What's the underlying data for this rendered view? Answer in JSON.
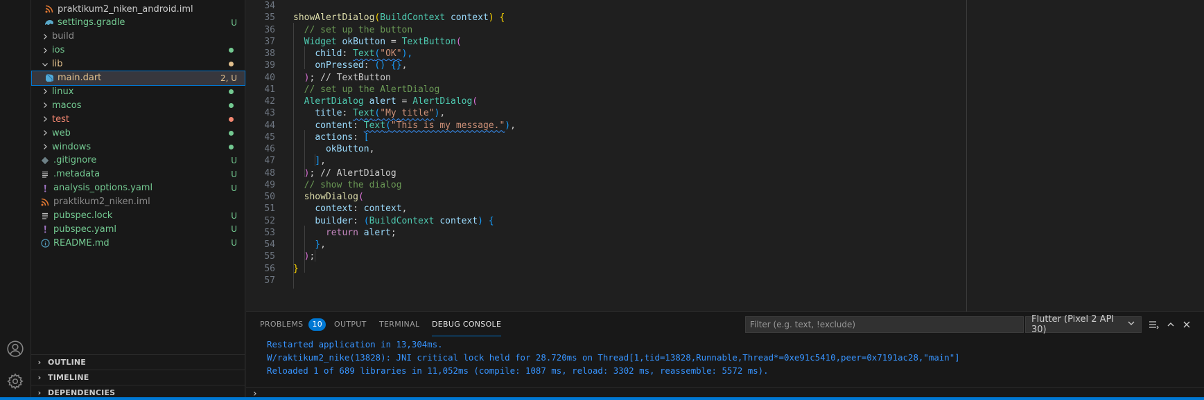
{
  "explorer": {
    "items": [
      {
        "label": "praktikum2_niken_android.iml",
        "icon": "rss-icon",
        "indent": 1,
        "color": "#cccccc",
        "badge": "",
        "dot": "",
        "chevron": "",
        "selected": false
      },
      {
        "label": "settings.gradle",
        "icon": "gradle-icon",
        "indent": 1,
        "color": "#73c991",
        "badge": "U",
        "dot": "",
        "chevron": "",
        "selected": false
      },
      {
        "label": "build",
        "icon": "",
        "indent": 0,
        "color": "#8c8c8c",
        "badge": "",
        "dot": "",
        "chevron": "right",
        "selected": false
      },
      {
        "label": "ios",
        "icon": "",
        "indent": 0,
        "color": "#73c991",
        "badge": "",
        "dot": "#73c991",
        "chevron": "right",
        "selected": false
      },
      {
        "label": "lib",
        "icon": "",
        "indent": 0,
        "color": "#e2c08d",
        "badge": "",
        "dot": "#e2c08d",
        "chevron": "down",
        "selected": false
      },
      {
        "label": "main.dart",
        "icon": "dart-icon",
        "indent": 1,
        "color": "#e2c08d",
        "badge": "2, U",
        "dot": "",
        "chevron": "",
        "selected": true
      },
      {
        "label": "linux",
        "icon": "",
        "indent": 0,
        "color": "#73c991",
        "badge": "",
        "dot": "#73c991",
        "chevron": "right",
        "selected": false
      },
      {
        "label": "macos",
        "icon": "",
        "indent": 0,
        "color": "#73c991",
        "badge": "",
        "dot": "#73c991",
        "chevron": "right",
        "selected": false
      },
      {
        "label": "test",
        "icon": "",
        "indent": 0,
        "color": "#f48771",
        "badge": "",
        "dot": "#f48771",
        "chevron": "right",
        "selected": false
      },
      {
        "label": "web",
        "icon": "",
        "indent": 0,
        "color": "#73c991",
        "badge": "",
        "dot": "#73c991",
        "chevron": "right",
        "selected": false
      },
      {
        "label": "windows",
        "icon": "",
        "indent": 0,
        "color": "#73c991",
        "badge": "",
        "dot": "#73c991",
        "chevron": "right",
        "selected": false
      },
      {
        "label": ".gitignore",
        "icon": "git-icon",
        "indent": 0,
        "color": "#73c991",
        "badge": "U",
        "dot": "",
        "chevron": "",
        "selected": false
      },
      {
        "label": ".metadata",
        "icon": "lines-icon",
        "indent": 0,
        "color": "#73c991",
        "badge": "U",
        "dot": "",
        "chevron": "",
        "selected": false
      },
      {
        "label": "analysis_options.yaml",
        "icon": "yaml-icon",
        "indent": 0,
        "color": "#73c991",
        "badge": "U",
        "dot": "",
        "chevron": "",
        "selected": false
      },
      {
        "label": "praktikum2_niken.iml",
        "icon": "rss-icon",
        "indent": 0,
        "color": "#8c8c8c",
        "badge": "",
        "dot": "",
        "chevron": "",
        "selected": false
      },
      {
        "label": "pubspec.lock",
        "icon": "lines-icon",
        "indent": 0,
        "color": "#73c991",
        "badge": "U",
        "dot": "",
        "chevron": "",
        "selected": false
      },
      {
        "label": "pubspec.yaml",
        "icon": "yaml-icon",
        "indent": 0,
        "color": "#73c991",
        "badge": "U",
        "dot": "",
        "chevron": "",
        "selected": false
      },
      {
        "label": "README.md",
        "icon": "info-icon",
        "indent": 0,
        "color": "#73c991",
        "badge": "U",
        "dot": "",
        "chevron": "",
        "selected": false
      }
    ],
    "sections": [
      "OUTLINE",
      "TIMELINE",
      "DEPENDENCIES"
    ]
  },
  "editor": {
    "lines": [
      {
        "n": "34",
        "tokens": []
      },
      {
        "n": "35",
        "tokens": [
          [
            "fn",
            "showAlertDialog"
          ],
          [
            "b1",
            "("
          ],
          [
            "type",
            "BuildContext"
          ],
          [
            "pn",
            " "
          ],
          [
            "var",
            "context"
          ],
          [
            "b1",
            ")"
          ],
          [
            "pn",
            " "
          ],
          [
            "b1",
            "{"
          ]
        ]
      },
      {
        "n": "36",
        "tokens": [
          [
            "pn",
            "  "
          ],
          [
            "cm",
            "// set up the button"
          ]
        ]
      },
      {
        "n": "37",
        "tokens": [
          [
            "pn",
            "  "
          ],
          [
            "type",
            "Widget"
          ],
          [
            "pn",
            " "
          ],
          [
            "var",
            "okButton"
          ],
          [
            "pn",
            " = "
          ],
          [
            "type",
            "TextButton"
          ],
          [
            "b2",
            "("
          ]
        ]
      },
      {
        "n": "38",
        "tokens": [
          [
            "pn",
            "    "
          ],
          [
            "var",
            "child"
          ],
          [
            "pn",
            ": "
          ],
          [
            "typesq",
            "Text"
          ],
          [
            "b3sq",
            "("
          ],
          [
            "strsq",
            "\"OK\""
          ],
          [
            "b3",
            "),"
          ]
        ]
      },
      {
        "n": "39",
        "tokens": [
          [
            "pn",
            "    "
          ],
          [
            "var",
            "onPressed"
          ],
          [
            "pn",
            ": "
          ],
          [
            "b3",
            "()"
          ],
          [
            "pn",
            " "
          ],
          [
            "b3",
            "{}"
          ],
          [
            "pn",
            ","
          ]
        ]
      },
      {
        "n": "40",
        "tokens": [
          [
            "pn",
            "  "
          ],
          [
            "b2",
            ")"
          ],
          [
            "pn",
            "; "
          ],
          [
            "pn",
            "// TextButton"
          ]
        ]
      },
      {
        "n": "41",
        "tokens": [
          [
            "pn",
            "  "
          ],
          [
            "cm",
            "// set up the AlertDialog"
          ]
        ]
      },
      {
        "n": "42",
        "tokens": [
          [
            "pn",
            "  "
          ],
          [
            "type",
            "AlertDialog"
          ],
          [
            "pn",
            " "
          ],
          [
            "var",
            "alert"
          ],
          [
            "pn",
            " = "
          ],
          [
            "type",
            "AlertDialog"
          ],
          [
            "b2",
            "("
          ]
        ]
      },
      {
        "n": "43",
        "tokens": [
          [
            "pn",
            "    "
          ],
          [
            "var",
            "title"
          ],
          [
            "pn",
            ": "
          ],
          [
            "typesq",
            "Text"
          ],
          [
            "b3sq",
            "("
          ],
          [
            "strsq",
            "\"My title\""
          ],
          [
            "b3",
            ")"
          ],
          [
            "pn",
            ","
          ]
        ]
      },
      {
        "n": "44",
        "tokens": [
          [
            "pn",
            "    "
          ],
          [
            "var",
            "content"
          ],
          [
            "pn",
            ": "
          ],
          [
            "typesq",
            "Text"
          ],
          [
            "b3sq",
            "("
          ],
          [
            "strsq",
            "\"This is my message.\""
          ],
          [
            "b3",
            ")"
          ],
          [
            "pn",
            ","
          ]
        ]
      },
      {
        "n": "45",
        "tokens": [
          [
            "pn",
            "    "
          ],
          [
            "var",
            "actions"
          ],
          [
            "pn",
            ": "
          ],
          [
            "b3",
            "["
          ]
        ]
      },
      {
        "n": "46",
        "tokens": [
          [
            "pn",
            "      "
          ],
          [
            "var",
            "okButton"
          ],
          [
            "pn",
            ","
          ]
        ]
      },
      {
        "n": "47",
        "tokens": [
          [
            "pn",
            "    "
          ],
          [
            "b3",
            "]"
          ],
          [
            "pn",
            ","
          ]
        ]
      },
      {
        "n": "48",
        "tokens": [
          [
            "pn",
            "  "
          ],
          [
            "b2",
            ")"
          ],
          [
            "pn",
            "; "
          ],
          [
            "pn",
            "// AlertDialog"
          ]
        ]
      },
      {
        "n": "49",
        "tokens": [
          [
            "pn",
            "  "
          ],
          [
            "cm",
            "// show the dialog"
          ]
        ]
      },
      {
        "n": "50",
        "tokens": [
          [
            "pn",
            "  "
          ],
          [
            "fn",
            "showDialog"
          ],
          [
            "b2",
            "("
          ]
        ]
      },
      {
        "n": "51",
        "tokens": [
          [
            "pn",
            "    "
          ],
          [
            "var",
            "context"
          ],
          [
            "pn",
            ": "
          ],
          [
            "var",
            "context"
          ],
          [
            "pn",
            ","
          ]
        ]
      },
      {
        "n": "52",
        "tokens": [
          [
            "pn",
            "    "
          ],
          [
            "var",
            "builder"
          ],
          [
            "pn",
            ": "
          ],
          [
            "b3",
            "("
          ],
          [
            "type",
            "BuildContext"
          ],
          [
            "pn",
            " "
          ],
          [
            "var",
            "context"
          ],
          [
            "b3",
            ")"
          ],
          [
            "pn",
            " "
          ],
          [
            "b3",
            "{"
          ]
        ]
      },
      {
        "n": "53",
        "tokens": [
          [
            "pn",
            "      "
          ],
          [
            "kw",
            "return"
          ],
          [
            "pn",
            " "
          ],
          [
            "var",
            "alert"
          ],
          [
            "pn",
            ";"
          ]
        ]
      },
      {
        "n": "54",
        "tokens": [
          [
            "pn",
            "    "
          ],
          [
            "b3",
            "}"
          ],
          [
            "pn",
            ","
          ]
        ]
      },
      {
        "n": "55",
        "tokens": [
          [
            "pn",
            "  "
          ],
          [
            "b2",
            ")"
          ],
          [
            "pn",
            ";"
          ]
        ]
      },
      {
        "n": "56",
        "tokens": [
          [
            "b1",
            "}"
          ]
        ]
      },
      {
        "n": "57",
        "tokens": []
      }
    ]
  },
  "panel": {
    "tabs": [
      {
        "label": "PROBLEMS",
        "badge": "10",
        "active": false
      },
      {
        "label": "OUTPUT",
        "badge": "",
        "active": false
      },
      {
        "label": "TERMINAL",
        "badge": "",
        "active": false
      },
      {
        "label": "DEBUG CONSOLE",
        "badge": "",
        "active": true
      }
    ],
    "filter_placeholder": "Filter (e.g. text, !exclude)",
    "device": "Flutter (Pixel 2 API 30)",
    "console": [
      "Restarted application in 13,304ms.",
      "W/raktikum2_nike(13828): JNI critical lock held for 28.720ms on Thread[1,tid=13828,Runnable,Thread*=0xe91c5410,peer=0x7191ac28,\"main\"]",
      "Reloaded 1 of 689 libraries in 11,052ms (compile: 1087 ms, reload: 3302 ms, reassemble: 5572 ms)."
    ],
    "prompt": "›"
  },
  "icons": {
    "account": "account-icon",
    "settings": "gear-icon",
    "more": "more-actions-icon",
    "maximize": "chevron-up-icon",
    "close": "close-icon",
    "select_chevron": "chevron-down-icon"
  }
}
